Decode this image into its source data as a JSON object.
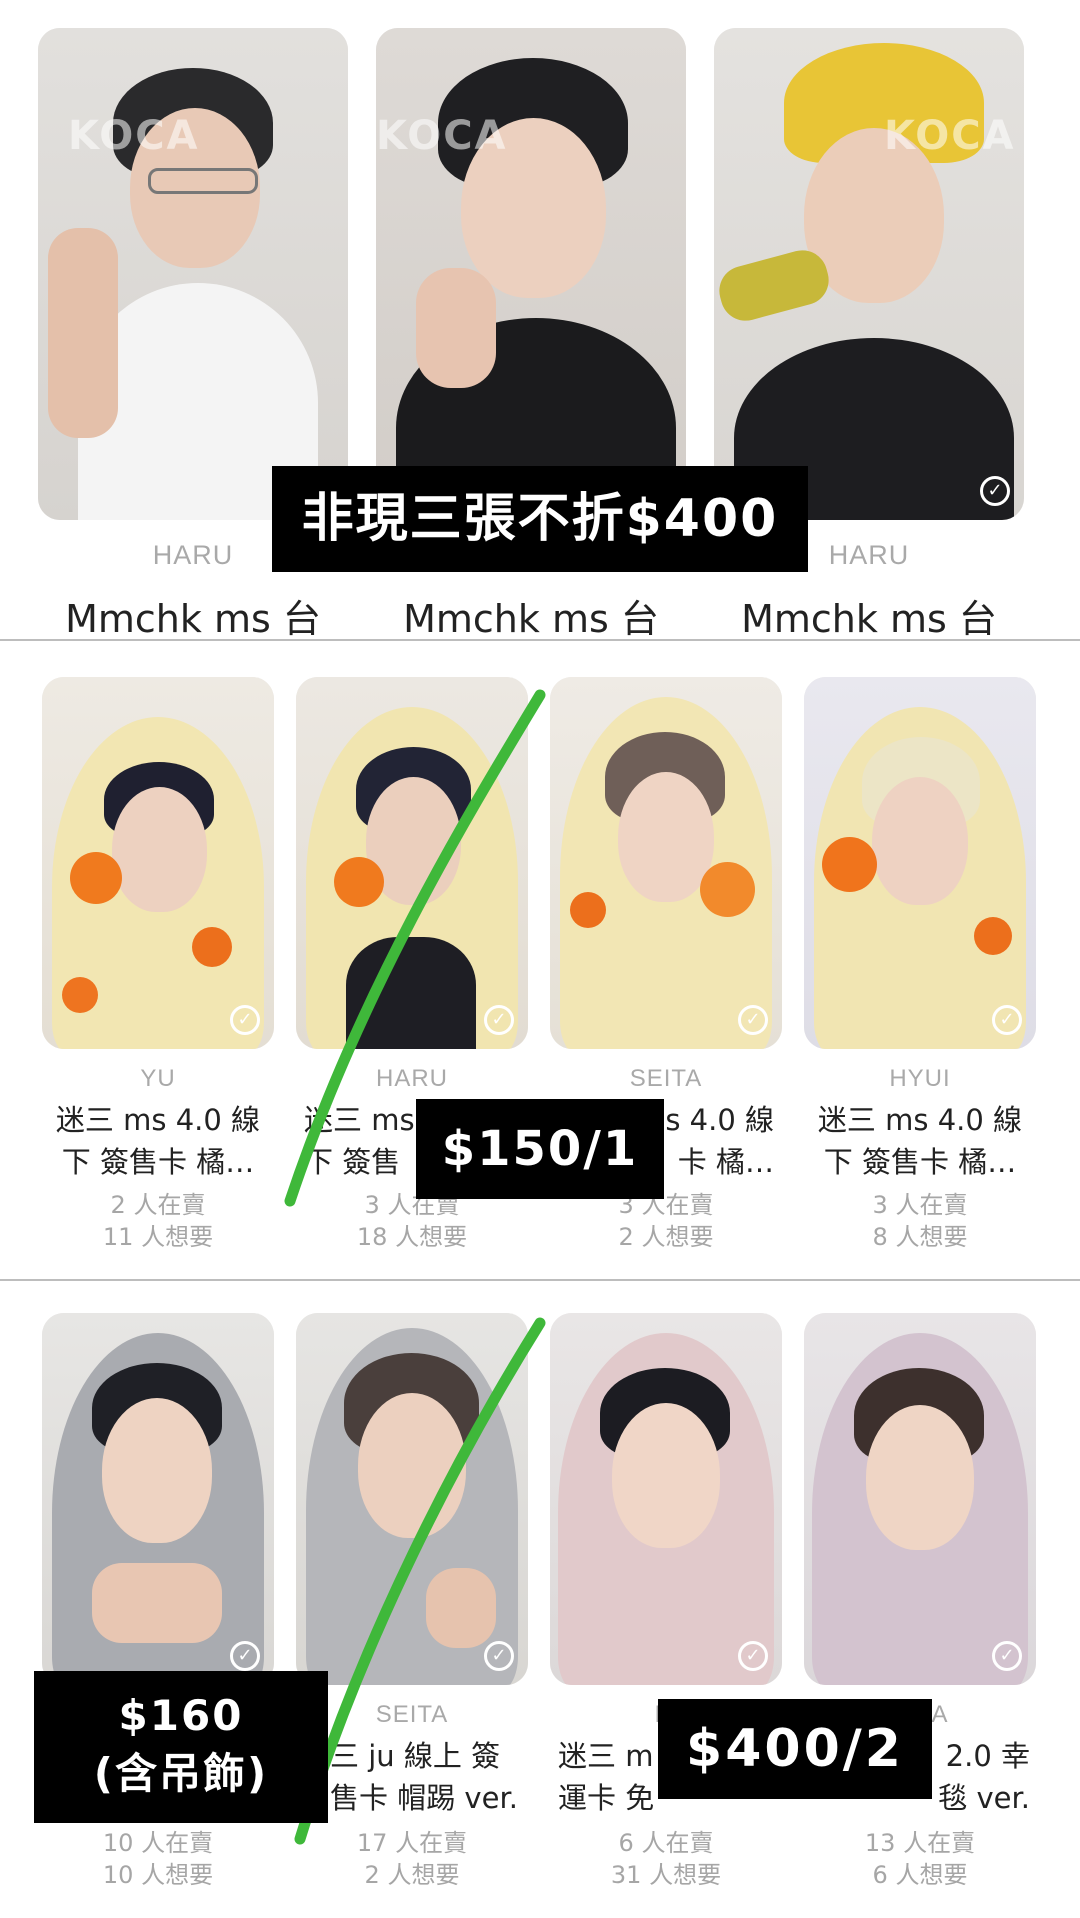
{
  "row1": {
    "cards": [
      {
        "member": "HARU",
        "title": "Mmchk ms 台"
      },
      {
        "member": "",
        "title": "Mmchk ms 台"
      },
      {
        "member": "HARU",
        "title": "Mmchk ms 台"
      }
    ],
    "overlay_label": "非現三張不折$400"
  },
  "row2": {
    "cards": [
      {
        "member": "YU",
        "title_line1": "迷三 ms 4.0 線",
        "title_line2": "下 簽售卡 橘…",
        "sellers": "2 人在賣",
        "wants": "11 人想要"
      },
      {
        "member": "HARU",
        "title_line1": "迷三 ms",
        "title_line2": "下 簽售",
        "sellers": "3 人在賣",
        "wants": "18 人想要"
      },
      {
        "member": "SEITA",
        "title_line1": "s 4.0 線",
        "title_line2": "卡 橘…",
        "sellers": "3 人在賣",
        "wants": "2 人想要"
      },
      {
        "member": "HYUI",
        "title_line1": "迷三 ms 4.0 線",
        "title_line2": "下 簽售卡 橘…",
        "sellers": "3 人在賣",
        "wants": "8 人想要"
      }
    ],
    "overlay_label": "$150/1"
  },
  "row3": {
    "cards": [
      {
        "member": "",
        "title_line1": "",
        "title_line2": "",
        "sellers": "10 人在賣",
        "wants": "10 人想要"
      },
      {
        "member": "SEITA",
        "title_line1": "三 ju 線上 簽",
        "title_line2": "售卡 帽踢 ver.",
        "sellers": "17 人在賣",
        "wants": "2 人想要"
      },
      {
        "member": "HA",
        "title_line1": "迷三 m",
        "title_line2": "運卡 免",
        "sellers": "6 人在賣",
        "wants": "31 人想要"
      },
      {
        "member": "A",
        "title_line1": "2.0 幸",
        "title_line2": "毯 ver.",
        "sellers": "13 人在賣",
        "wants": "6 人想要"
      }
    ],
    "overlay_label_left_line1": "$160",
    "overlay_label_left_line2": "(含吊飾)",
    "overlay_label_right": "$400/2"
  },
  "watermark_text": "KOCA",
  "colors": {
    "strike": "#3fb83a",
    "label_bg": "#000000",
    "label_text": "#ffffff",
    "divider": "#bdbdbd",
    "muted_text": "#a6a6a6"
  }
}
